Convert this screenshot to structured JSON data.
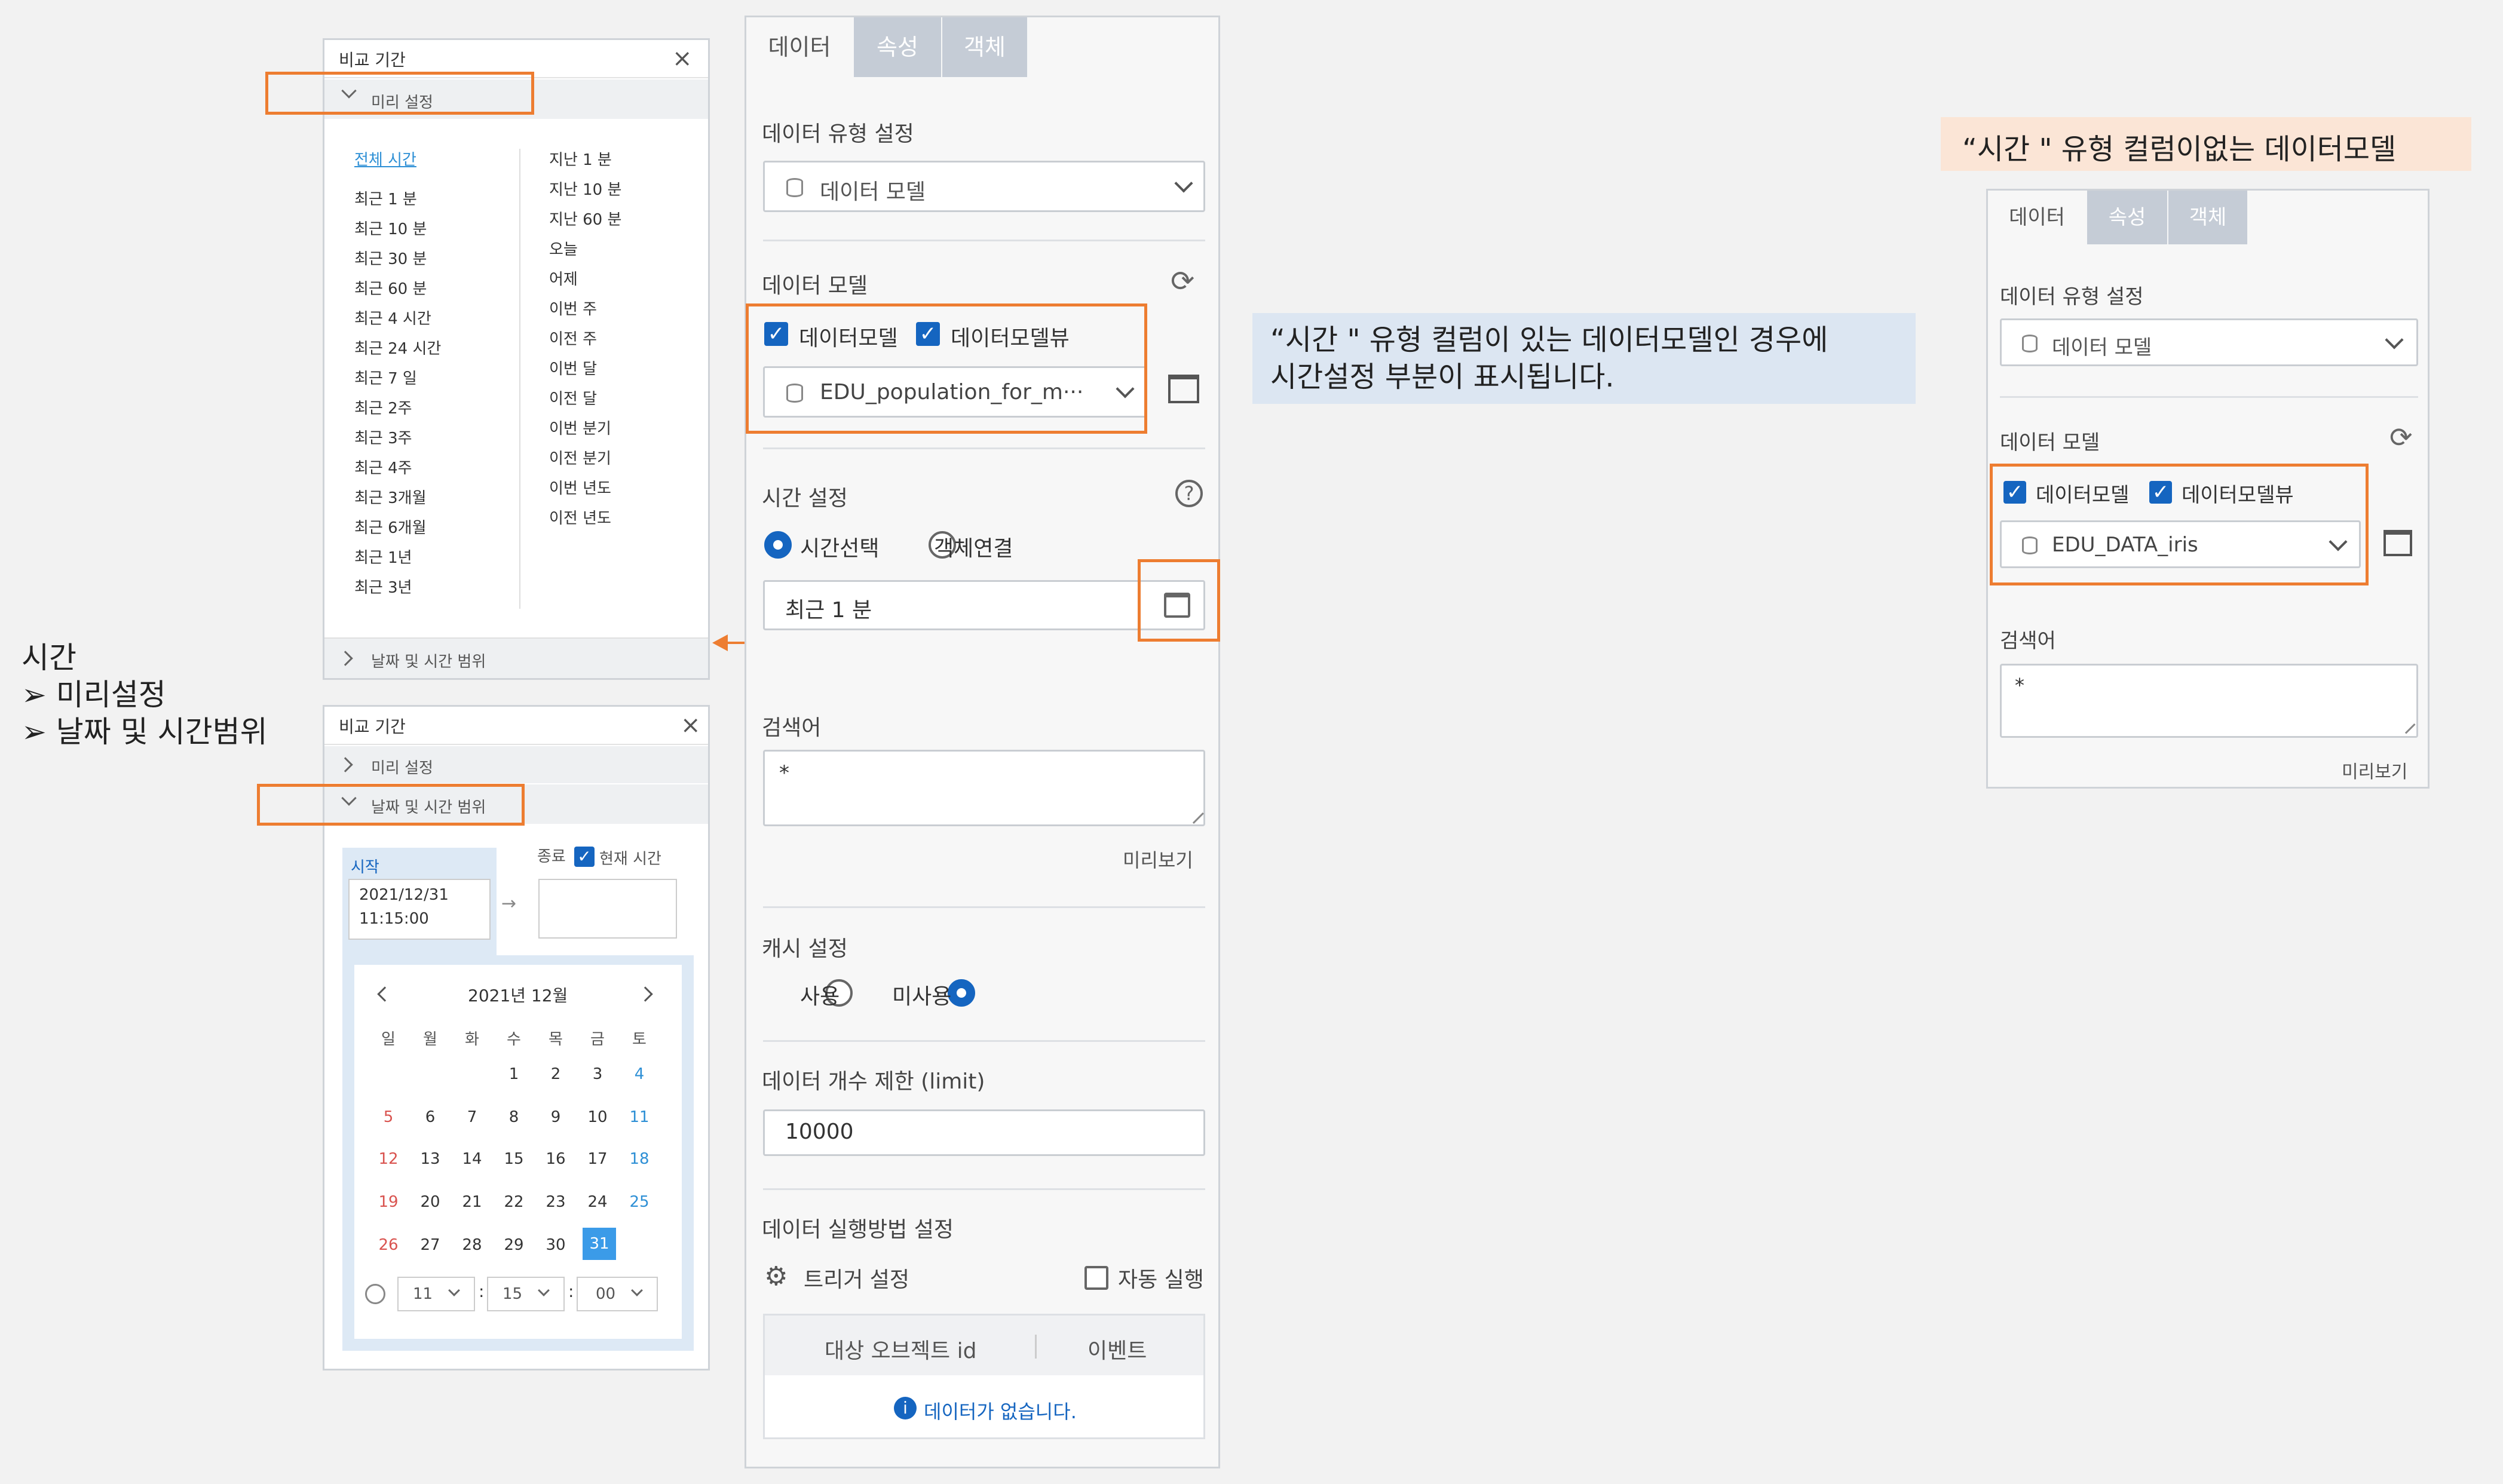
{
  "compare_preset": {
    "title": "비교 기간",
    "close_icon": "close-icon",
    "section_preset": "미리 설정",
    "section_range": "날짜 및 시간 범위",
    "col1": [
      "전체 시간",
      "최근 1 분",
      "최근 10 분",
      "최근 30 분",
      "최근 60 분",
      "최근 4 시간",
      "최근 24 시간",
      "최근 7 일",
      "최근 2주",
      "최근 3주",
      "최근 4주",
      "최근 3개월",
      "최근 6개월",
      "최근 1년",
      "최근 3년"
    ],
    "col2": [
      "지난 1 분",
      "지난 10 분",
      "지난 60 분",
      "오늘",
      "어제",
      "이번 주",
      "이전 주",
      "이번 달",
      "이전 달",
      "이번 분기",
      "이전 분기",
      "이번 년도",
      "이전 년도"
    ]
  },
  "compare_range": {
    "title": "비교 기간",
    "section_preset": "미리 설정",
    "section_range": "날짜 및 시간 범위",
    "start_label": "시작",
    "start_date": "2021/12/31",
    "start_time": "11:15:00",
    "end_label": "종료",
    "now_label": "현재 시간",
    "month": "2021년 12월",
    "weekdays": [
      "일",
      "월",
      "화",
      "수",
      "목",
      "금",
      "토"
    ],
    "days": [
      "1",
      "2",
      "3",
      "4",
      "5",
      "6",
      "7",
      "8",
      "9",
      "10",
      "11",
      "12",
      "13",
      "14",
      "15",
      "16",
      "17",
      "18",
      "19",
      "20",
      "21",
      "22",
      "23",
      "24",
      "25",
      "26",
      "27",
      "28",
      "29",
      "30",
      "31"
    ],
    "hour": "11",
    "minute": "15",
    "second": "00",
    "selected_day": "31"
  },
  "side_note": {
    "title": "시간",
    "items": [
      "미리설정",
      "날짜 및 시간범위"
    ]
  },
  "main": {
    "tabs": [
      "데이터",
      "속성",
      "객체"
    ],
    "data_type_label": "데이터 유형 설정",
    "data_type_value": "데이터 모델",
    "data_model_label": "데이터 모델",
    "chk_model": "데이터모델",
    "chk_view": "데이터모델뷰",
    "model_value": "EDU_population_for_m···",
    "time_label": "시간 설정",
    "radio_time": "시간선택",
    "radio_object": "객체연결",
    "time_value": "최근 1 분",
    "search_label": "검색어",
    "search_value": "*",
    "preview": "미리보기",
    "cache_label": "캐시 설정",
    "cache_use": "사용",
    "cache_nouse": "미사용",
    "limit_label": "데이터 개수 제한 (limit)",
    "limit_value": "10000",
    "exec_label": "데이터 실행방법 설정",
    "trigger": "트리거 설정",
    "auto_run": "자동 실행",
    "col_target": "대상 오브젝트 id",
    "col_event": "이벤트",
    "empty": "데이터가 없습니다."
  },
  "note_with_time": {
    "line1": "“시간 \"  유형 컬럼이 있는 데이터모델인 경우에",
    "line2": "시간설정 부분이 표시됩니다."
  },
  "note_without_time": "“시간 \"  유형 컬럼이없는 데이터모델",
  "right": {
    "tabs": [
      "데이터",
      "속성",
      "객체"
    ],
    "data_type_label": "데이터 유형 설정",
    "data_type_value": "데이터 모델",
    "data_model_label": "데이터 모델",
    "chk_model": "데이터모델",
    "chk_view": "데이터모델뷰",
    "model_value": "EDU_DATA_iris",
    "search_label": "검색어",
    "search_value": "*",
    "preview": "미리보기"
  },
  "colors": {
    "accent": "#1565c0",
    "highlight": "#ed7d31",
    "note_blue": "#dce6f2",
    "note_peach": "#fbe5d6"
  }
}
